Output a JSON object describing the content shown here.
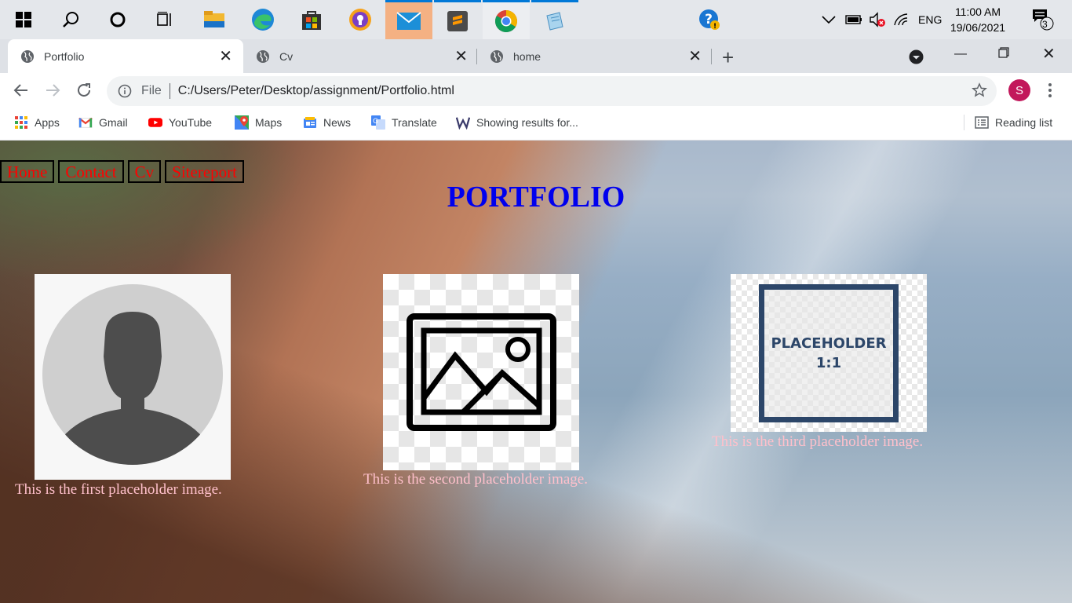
{
  "taskbar": {
    "tray_lang": "ENG",
    "time": "11:00 AM",
    "date": "19/06/2021",
    "notification_count": "3"
  },
  "tabs": [
    {
      "title": "Portfolio",
      "active": true
    },
    {
      "title": "Cv",
      "active": false
    },
    {
      "title": "home",
      "active": false
    }
  ],
  "omnibox": {
    "scheme_label": "File",
    "url": "C:/Users/Peter/Desktop/assignment/Portfolio.html",
    "profile_initial": "S"
  },
  "bookmarks": {
    "items": [
      "Apps",
      "Gmail",
      "YouTube",
      "Maps",
      "News",
      "Translate",
      "Showing results for..."
    ],
    "reading_list": "Reading list"
  },
  "page": {
    "nav": [
      "Home",
      "Contact",
      "Cv",
      "Sitereport"
    ],
    "heading": "PORTFOLIO",
    "captions": [
      "This is the first placeholder image.",
      "This is the second placeholder image.",
      "This is the third placeholder image."
    ],
    "placeholder_text": [
      "PLACEHOLDER",
      "1:1"
    ]
  },
  "colors": {
    "nav_link": "#ff0000",
    "heading": "#0000ee",
    "caption": "#ffc0cb",
    "profile": "#c2185b"
  }
}
